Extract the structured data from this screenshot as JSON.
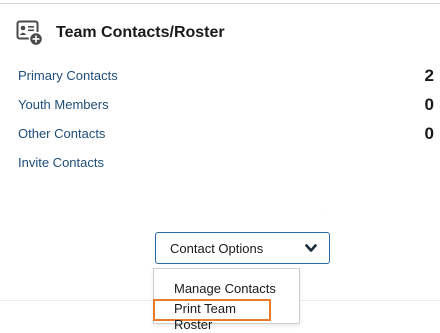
{
  "panel": {
    "title": "Team Contacts/Roster",
    "icon": "contact-card-add-icon"
  },
  "rows": [
    {
      "label": "Primary Contacts",
      "count": "2"
    },
    {
      "label": "Youth Members",
      "count": "0"
    },
    {
      "label": "Other Contacts",
      "count": "0"
    },
    {
      "label": "Invite Contacts",
      "count": ""
    }
  ],
  "contact_options": {
    "label": "Contact Options",
    "icon": "chevron-down-icon",
    "menu_items": [
      "Manage Contacts",
      "Print Team Roster"
    ]
  },
  "colors": {
    "link": "#1f4e79",
    "accent_border": "#2b6aa8",
    "highlight": "#e77b2e"
  }
}
